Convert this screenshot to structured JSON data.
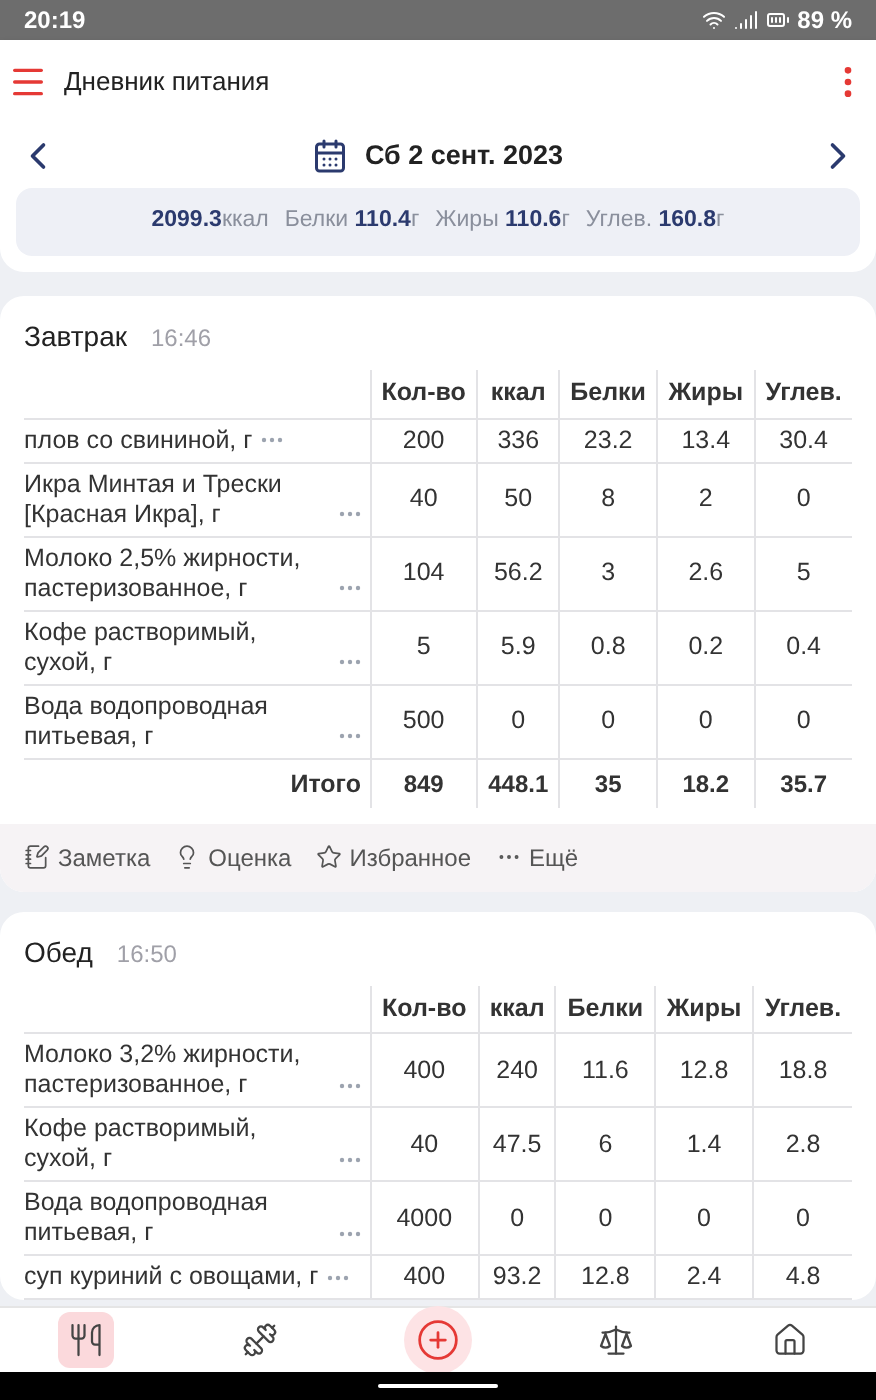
{
  "status_bar": {
    "time": "20:19",
    "battery": "89 %"
  },
  "app_bar": {
    "title": "Дневник питания"
  },
  "date_nav": {
    "date": "Сб 2 сент. 2023"
  },
  "summary": [
    {
      "value": "2099.3",
      "unit": "ккал"
    },
    {
      "label": "Белки",
      "value": "110.4",
      "unit": "г"
    },
    {
      "label": "Жиры",
      "value": "110.6",
      "unit": "г"
    },
    {
      "label": "Углев.",
      "value": "160.8",
      "unit": "г"
    }
  ],
  "meals": [
    {
      "name": "Завтрак",
      "time": "16:46",
      "columns": [
        "Кол-во",
        "ккал",
        "Белки",
        "Жиры",
        "Углев."
      ],
      "rows": [
        {
          "name": "плов со свининой, г",
          "values": [
            "200",
            "336",
            "23.2",
            "13.4",
            "30.4"
          ]
        },
        {
          "name": "Икра Минтая и Трески [Красная Икра], г",
          "values": [
            "40",
            "50",
            "8",
            "2",
            "0"
          ]
        },
        {
          "name": "Молоко 2,5% жирности, пастеризованное, г",
          "values": [
            "104",
            "56.2",
            "3",
            "2.6",
            "5"
          ]
        },
        {
          "name": "Кофе растворимый, сухой, г",
          "values": [
            "5",
            "5.9",
            "0.8",
            "0.2",
            "0.4"
          ]
        },
        {
          "name": "Вода водопроводная питьевая, г",
          "values": [
            "500",
            "0",
            "0",
            "0",
            "0"
          ]
        }
      ],
      "total": {
        "label": "Итого",
        "values": [
          "849",
          "448.1",
          "35",
          "18.2",
          "35.7"
        ]
      },
      "actions": [
        {
          "kind": "note",
          "label": "Заметка"
        },
        {
          "kind": "rating",
          "label": "Оценка"
        },
        {
          "kind": "favorite",
          "label": "Избранное"
        },
        {
          "kind": "more",
          "label": "Ещё"
        }
      ]
    },
    {
      "name": "Обед",
      "time": "16:50",
      "columns": [
        "Кол-во",
        "ккал",
        "Белки",
        "Жиры",
        "Углев."
      ],
      "rows": [
        {
          "name": "Молоко 3,2% жирности, пастеризованное, г",
          "values": [
            "400",
            "240",
            "11.6",
            "12.8",
            "18.8"
          ]
        },
        {
          "name": "Кофе растворимый, сухой, г",
          "values": [
            "40",
            "47.5",
            "6",
            "1.4",
            "2.8"
          ]
        },
        {
          "name": "Вода водопроводная питьевая, г",
          "values": [
            "4000",
            "0",
            "0",
            "0",
            "0"
          ]
        },
        {
          "name": "суп куриний с овощами, г",
          "values": [
            "400",
            "93.2",
            "12.8",
            "2.4",
            "4.8"
          ]
        }
      ]
    }
  ],
  "bottom_nav": [
    {
      "kind": "diary",
      "selected": true
    },
    {
      "kind": "workout",
      "selected": false
    },
    {
      "kind": "add",
      "selected": true
    },
    {
      "kind": "scale",
      "selected": false
    },
    {
      "kind": "home",
      "selected": false
    }
  ]
}
